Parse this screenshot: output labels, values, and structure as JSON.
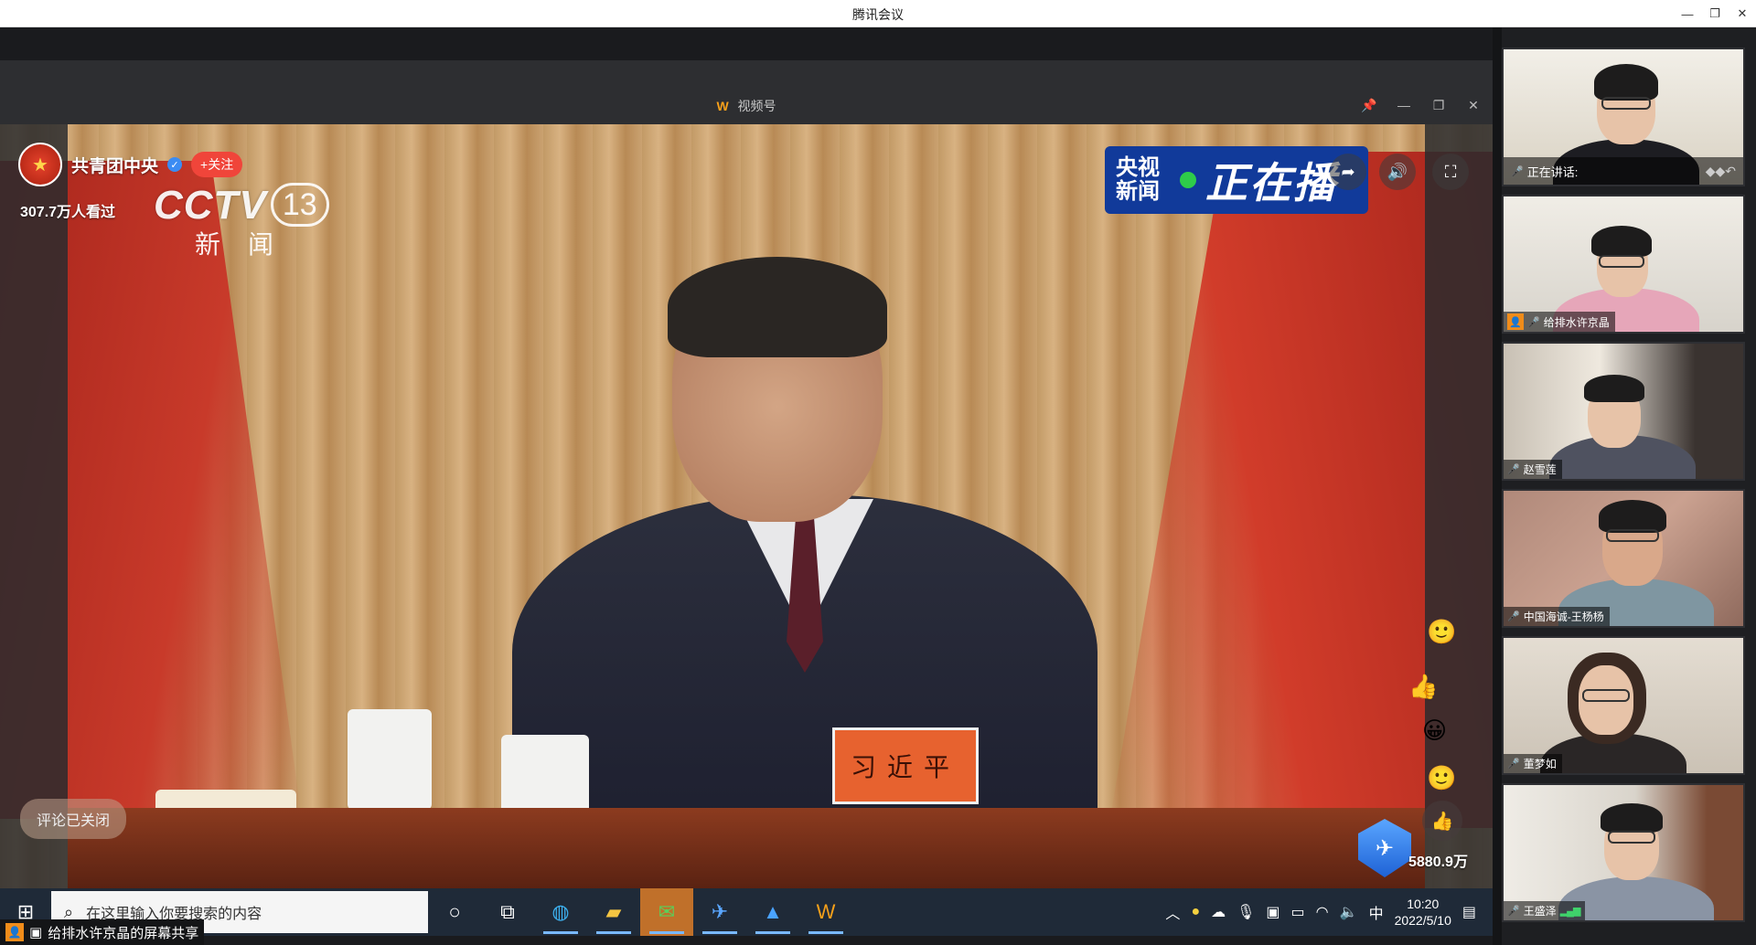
{
  "app": {
    "title": "腾讯会议",
    "window_controls": [
      "—",
      "❐",
      "✕"
    ]
  },
  "shared_window": {
    "title": "视频号",
    "logo_glyph": "W",
    "controls": [
      "📌",
      "—",
      "❐",
      "✕"
    ]
  },
  "video": {
    "channel": {
      "name": "共青团中央",
      "follow_label": "+关注",
      "viewers": "307.7万人看过"
    },
    "station_logo": {
      "brand": "CCTV",
      "number": "13",
      "sub": "新闻"
    },
    "live_badge": {
      "line1": "央视",
      "line2": "新闻",
      "main": "正在播"
    },
    "nameplate": "习近平",
    "comments_status": "评论已关闭",
    "like_count": "5880.9万"
  },
  "taskbar": {
    "search_placeholder": "在这里输入你要搜索的内容",
    "tray_lang": "中",
    "time": "10:20",
    "date": "2022/5/10"
  },
  "share_bar": {
    "label": "给排水许京晶的屏幕共享"
  },
  "participants": [
    {
      "label": "正在讲话:",
      "speaking": true
    },
    {
      "label": "给排水许京晶",
      "host": true
    },
    {
      "label": "赵雪莲"
    },
    {
      "label": "中国海诚-王杨杨"
    },
    {
      "label": "董梦如"
    },
    {
      "label": "王盛泽",
      "signal": true
    }
  ],
  "colors": {
    "accent": "#f08c1a",
    "live_blue": "#113a9a",
    "follow_red": "#f0453a"
  }
}
